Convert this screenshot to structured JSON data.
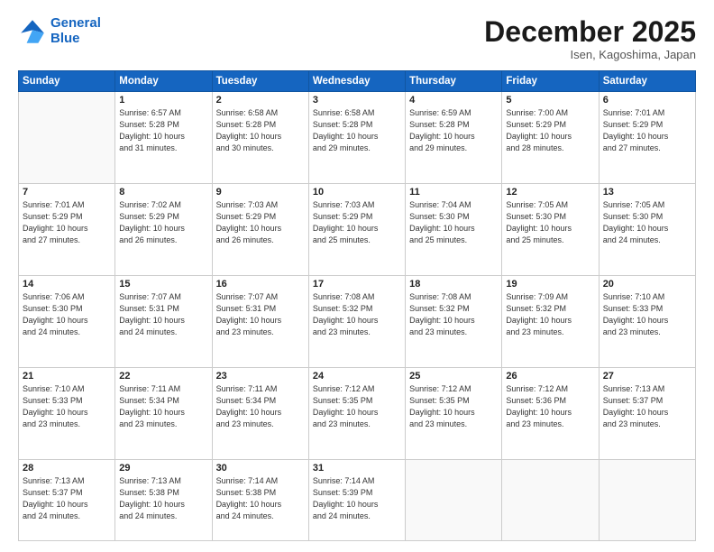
{
  "logo": {
    "line1": "General",
    "line2": "Blue"
  },
  "header": {
    "month": "December 2025",
    "location": "Isen, Kagoshima, Japan"
  },
  "weekdays": [
    "Sunday",
    "Monday",
    "Tuesday",
    "Wednesday",
    "Thursday",
    "Friday",
    "Saturday"
  ],
  "weeks": [
    [
      {
        "day": "",
        "info": ""
      },
      {
        "day": "1",
        "info": "Sunrise: 6:57 AM\nSunset: 5:28 PM\nDaylight: 10 hours\nand 31 minutes."
      },
      {
        "day": "2",
        "info": "Sunrise: 6:58 AM\nSunset: 5:28 PM\nDaylight: 10 hours\nand 30 minutes."
      },
      {
        "day": "3",
        "info": "Sunrise: 6:58 AM\nSunset: 5:28 PM\nDaylight: 10 hours\nand 29 minutes."
      },
      {
        "day": "4",
        "info": "Sunrise: 6:59 AM\nSunset: 5:28 PM\nDaylight: 10 hours\nand 29 minutes."
      },
      {
        "day": "5",
        "info": "Sunrise: 7:00 AM\nSunset: 5:29 PM\nDaylight: 10 hours\nand 28 minutes."
      },
      {
        "day": "6",
        "info": "Sunrise: 7:01 AM\nSunset: 5:29 PM\nDaylight: 10 hours\nand 27 minutes."
      }
    ],
    [
      {
        "day": "7",
        "info": "Sunrise: 7:01 AM\nSunset: 5:29 PM\nDaylight: 10 hours\nand 27 minutes."
      },
      {
        "day": "8",
        "info": "Sunrise: 7:02 AM\nSunset: 5:29 PM\nDaylight: 10 hours\nand 26 minutes."
      },
      {
        "day": "9",
        "info": "Sunrise: 7:03 AM\nSunset: 5:29 PM\nDaylight: 10 hours\nand 26 minutes."
      },
      {
        "day": "10",
        "info": "Sunrise: 7:03 AM\nSunset: 5:29 PM\nDaylight: 10 hours\nand 25 minutes."
      },
      {
        "day": "11",
        "info": "Sunrise: 7:04 AM\nSunset: 5:30 PM\nDaylight: 10 hours\nand 25 minutes."
      },
      {
        "day": "12",
        "info": "Sunrise: 7:05 AM\nSunset: 5:30 PM\nDaylight: 10 hours\nand 25 minutes."
      },
      {
        "day": "13",
        "info": "Sunrise: 7:05 AM\nSunset: 5:30 PM\nDaylight: 10 hours\nand 24 minutes."
      }
    ],
    [
      {
        "day": "14",
        "info": "Sunrise: 7:06 AM\nSunset: 5:30 PM\nDaylight: 10 hours\nand 24 minutes."
      },
      {
        "day": "15",
        "info": "Sunrise: 7:07 AM\nSunset: 5:31 PM\nDaylight: 10 hours\nand 24 minutes."
      },
      {
        "day": "16",
        "info": "Sunrise: 7:07 AM\nSunset: 5:31 PM\nDaylight: 10 hours\nand 23 minutes."
      },
      {
        "day": "17",
        "info": "Sunrise: 7:08 AM\nSunset: 5:32 PM\nDaylight: 10 hours\nand 23 minutes."
      },
      {
        "day": "18",
        "info": "Sunrise: 7:08 AM\nSunset: 5:32 PM\nDaylight: 10 hours\nand 23 minutes."
      },
      {
        "day": "19",
        "info": "Sunrise: 7:09 AM\nSunset: 5:32 PM\nDaylight: 10 hours\nand 23 minutes."
      },
      {
        "day": "20",
        "info": "Sunrise: 7:10 AM\nSunset: 5:33 PM\nDaylight: 10 hours\nand 23 minutes."
      }
    ],
    [
      {
        "day": "21",
        "info": "Sunrise: 7:10 AM\nSunset: 5:33 PM\nDaylight: 10 hours\nand 23 minutes."
      },
      {
        "day": "22",
        "info": "Sunrise: 7:11 AM\nSunset: 5:34 PM\nDaylight: 10 hours\nand 23 minutes."
      },
      {
        "day": "23",
        "info": "Sunrise: 7:11 AM\nSunset: 5:34 PM\nDaylight: 10 hours\nand 23 minutes."
      },
      {
        "day": "24",
        "info": "Sunrise: 7:12 AM\nSunset: 5:35 PM\nDaylight: 10 hours\nand 23 minutes."
      },
      {
        "day": "25",
        "info": "Sunrise: 7:12 AM\nSunset: 5:35 PM\nDaylight: 10 hours\nand 23 minutes."
      },
      {
        "day": "26",
        "info": "Sunrise: 7:12 AM\nSunset: 5:36 PM\nDaylight: 10 hours\nand 23 minutes."
      },
      {
        "day": "27",
        "info": "Sunrise: 7:13 AM\nSunset: 5:37 PM\nDaylight: 10 hours\nand 23 minutes."
      }
    ],
    [
      {
        "day": "28",
        "info": "Sunrise: 7:13 AM\nSunset: 5:37 PM\nDaylight: 10 hours\nand 24 minutes."
      },
      {
        "day": "29",
        "info": "Sunrise: 7:13 AM\nSunset: 5:38 PM\nDaylight: 10 hours\nand 24 minutes."
      },
      {
        "day": "30",
        "info": "Sunrise: 7:14 AM\nSunset: 5:38 PM\nDaylight: 10 hours\nand 24 minutes."
      },
      {
        "day": "31",
        "info": "Sunrise: 7:14 AM\nSunset: 5:39 PM\nDaylight: 10 hours\nand 24 minutes."
      },
      {
        "day": "",
        "info": ""
      },
      {
        "day": "",
        "info": ""
      },
      {
        "day": "",
        "info": ""
      }
    ]
  ]
}
